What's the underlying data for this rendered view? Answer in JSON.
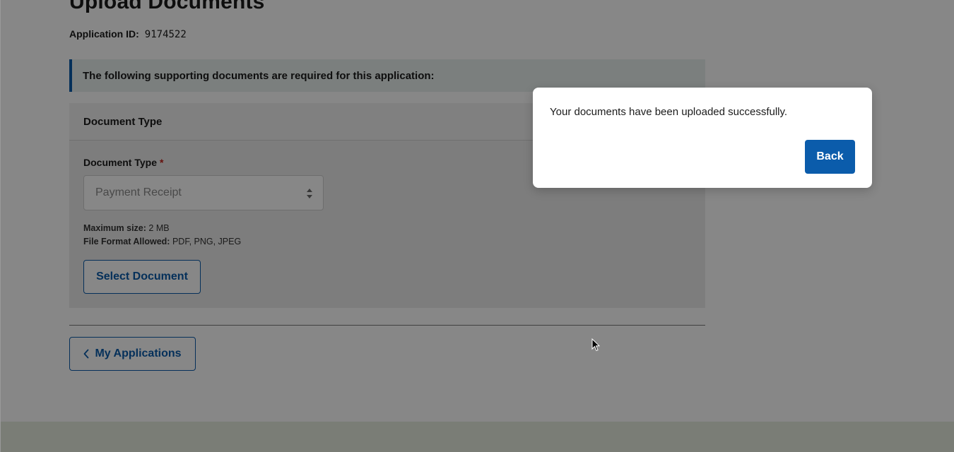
{
  "page": {
    "title": "Upload Documents",
    "application_id_label": "Application ID:",
    "application_id_value": "9174522",
    "info_banner": "The following supporting documents are required for this application:"
  },
  "document_card": {
    "header": "Document Type",
    "field_label": "Document Type",
    "required_marker": "*",
    "select_value": "Payment Receipt",
    "max_size_label": "Maximum size:",
    "max_size_value": "2 MB",
    "file_format_label": "File Format Allowed:",
    "file_format_value": "PDF, PNG, JPEG",
    "select_button_label": "Select Document"
  },
  "navigation": {
    "my_applications_label": "My Applications"
  },
  "modal": {
    "message": "Your documents have been uploaded successfully.",
    "back_label": "Back"
  },
  "colors": {
    "primary": "#0b5cab",
    "required": "#c0201a",
    "banner_bg": "#e8f0ef",
    "overlay": "rgba(0,0,0,0.47)"
  },
  "icons": {
    "select_arrows": "sort-arrows-icon",
    "back_chevron": "chevron-left-icon",
    "cursor": "mouse-pointer-icon"
  }
}
